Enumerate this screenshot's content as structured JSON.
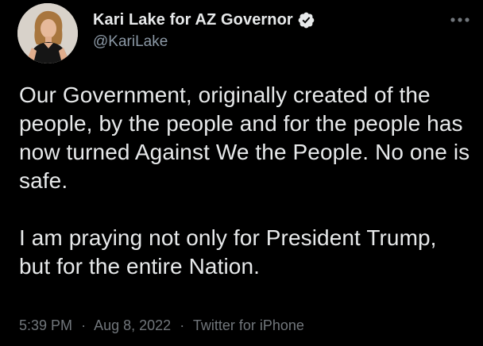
{
  "author": {
    "display_name": "Kari Lake for AZ Governor",
    "handle": "@KariLake",
    "verified": true,
    "avatar_icon": "profile-photo"
  },
  "tweet": {
    "paragraphs": [
      "Our Government, originally created of the people, by the people and for the people has now turned Against We the People. No one is safe.",
      "I am praying not only for President Trump, but for the entire Nation."
    ]
  },
  "meta": {
    "time": "5:39 PM",
    "separator": "·",
    "date": "Aug 8, 2022",
    "source": "Twitter for iPhone"
  },
  "icons": {
    "verified": "verified-badge-icon",
    "more": "more-options-icon"
  },
  "colors": {
    "background": "#000000",
    "text": "#e7e9ea",
    "secondary": "#71767b",
    "verified_badge": "#e7e9ea"
  }
}
